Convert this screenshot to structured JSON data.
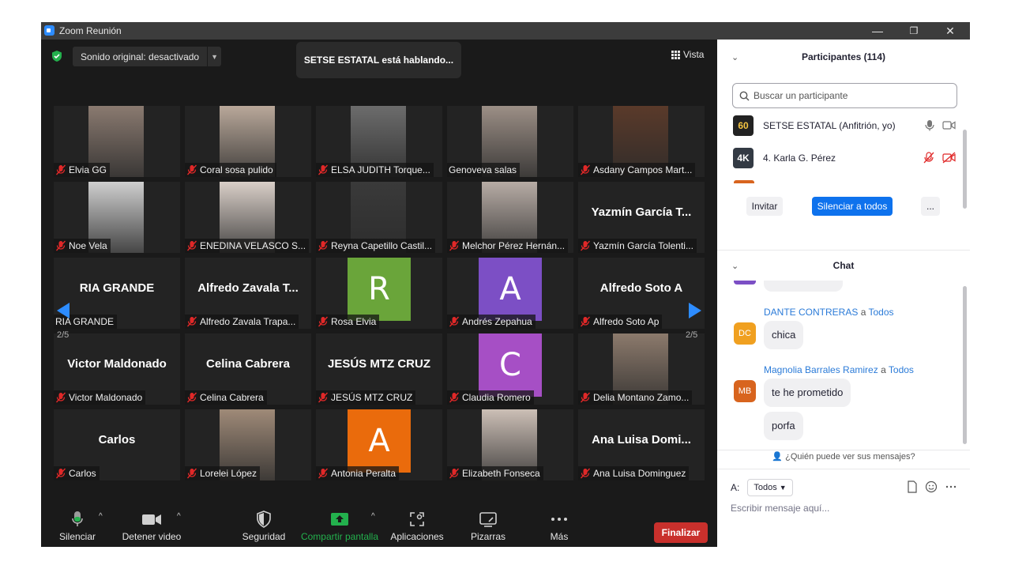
{
  "window": {
    "title": "Zoom Reunión",
    "minimize": "—",
    "restore": "❐",
    "close": "✕"
  },
  "meeting": {
    "original_sound": "Sonido original: desactivado",
    "speaking": "SETSE ESTATAL está hablando...",
    "view": "Vista",
    "page_left": "2/5",
    "page_right": "2/5"
  },
  "tiles": [
    {
      "label": "Elvia GG",
      "big": "",
      "kind": "photo",
      "color": "#8a7a70",
      "muted": true
    },
    {
      "label": "Coral sosa pulido",
      "big": "",
      "kind": "photo",
      "color": "#b9a89a",
      "muted": true
    },
    {
      "label": "ELSA JUDITH Torque...",
      "big": "",
      "kind": "photo",
      "color": "#6c6c6c",
      "muted": true
    },
    {
      "label": "Genoveva salas",
      "big": "",
      "kind": "photo",
      "color": "#9c8f86",
      "muted": false
    },
    {
      "label": "Asdany Campos Mart...",
      "big": "",
      "kind": "photo",
      "color": "#5a3a2a",
      "muted": true
    },
    {
      "label": "Noe Vela",
      "big": "",
      "kind": "photo",
      "color": "#cfcfcf",
      "muted": true
    },
    {
      "label": "ENEDINA VELASCO S...",
      "big": "",
      "kind": "photo",
      "color": "#d9cfc8",
      "muted": true
    },
    {
      "label": "Reyna Capetillo Castil...",
      "big": "",
      "kind": "photo",
      "color": "#3a3a3a",
      "muted": true
    },
    {
      "label": "Melchor Pérez Hernán...",
      "big": "",
      "kind": "photo",
      "color": "#b7aca5",
      "muted": true
    },
    {
      "label": "Yazmín García Tolenti...",
      "big": "Yazmín García T...",
      "kind": "name",
      "color": "",
      "muted": true
    },
    {
      "label": "RIA GRANDE",
      "big": "RIA GRANDE",
      "kind": "name",
      "color": "",
      "muted": false
    },
    {
      "label": "Alfredo Zavala Trapa...",
      "big": "Alfredo Zavala T...",
      "kind": "name",
      "color": "",
      "muted": true
    },
    {
      "label": "Rosa Elvia",
      "big": "R",
      "kind": "avatar",
      "color": "#6aa53a",
      "muted": true
    },
    {
      "label": "Andrés Zepahua",
      "big": "A",
      "kind": "avatar",
      "color": "#7c4fc5",
      "muted": true
    },
    {
      "label": "Alfredo Soto Ap",
      "big": "Alfredo Soto A",
      "kind": "name",
      "color": "",
      "muted": true
    },
    {
      "label": "Victor Maldonado",
      "big": "Victor Maldonado",
      "kind": "name",
      "color": "",
      "muted": true
    },
    {
      "label": "Celina Cabrera",
      "big": "Celina Cabrera",
      "kind": "name",
      "color": "",
      "muted": true
    },
    {
      "label": "JESÚS MTZ CRUZ",
      "big": "JESÚS MTZ CRUZ",
      "kind": "name",
      "color": "",
      "muted": true
    },
    {
      "label": "Claudia Romero",
      "big": "C",
      "kind": "avatar",
      "color": "#a64fc5",
      "muted": true
    },
    {
      "label": "Delia Montano Zamo...",
      "big": "",
      "kind": "photo",
      "color": "#8c7a6c",
      "muted": true
    },
    {
      "label": "Carlos",
      "big": "Carlos",
      "kind": "name",
      "color": "",
      "muted": true
    },
    {
      "label": "Lorelei López",
      "big": "",
      "kind": "photo",
      "color": "#9f8a78",
      "muted": true
    },
    {
      "label": "Antonia Peralta",
      "big": "A",
      "kind": "avatar",
      "color": "#ea6b0c",
      "muted": true
    },
    {
      "label": "Elizabeth Fonseca",
      "big": "",
      "kind": "photo",
      "color": "#ccbfb6",
      "muted": true
    },
    {
      "label": "Ana Luisa Dominguez",
      "big": "Ana Luisa Domi...",
      "kind": "name",
      "color": "",
      "muted": true
    }
  ],
  "toolbar": {
    "mute": "Silenciar",
    "video": "Detener video",
    "security": "Seguridad",
    "share": "Compartir pantalla",
    "apps": "Aplicaciones",
    "whiteboards": "Pizarras",
    "more": "Más",
    "end": "Finalizar"
  },
  "participants": {
    "title": "Participantes (114)",
    "search_placeholder": "Buscar un participante",
    "list": [
      {
        "avatar": "60",
        "name": "SETSE ESTATAL (Anfitrión, yo)",
        "color": "#222222"
      },
      {
        "avatar": "4K",
        "name": "4. Karla G. Pérez",
        "color": "#333a44"
      }
    ],
    "invite": "Invitar",
    "mute_all": "Silenciar a todos",
    "more": "..."
  },
  "chat": {
    "title": "Chat",
    "messages": [
      {
        "sender": "DANTE CONTRERAS",
        "to_word": "a",
        "to": "Todos",
        "initials": "DC",
        "color": "#f0a020",
        "text": "chica"
      },
      {
        "sender": "Magnolia Barrales Ramirez",
        "to_word": "a",
        "to": "Todos",
        "initials": "MB",
        "color": "#d8641e",
        "text": "te he prometido",
        "text2": "porfa"
      }
    ],
    "who_sees": "¿Quién puede ver sus mensajes?",
    "to_label": "A:",
    "to_value": "Todos",
    "input_placeholder": "Escribir mensaje aquí..."
  }
}
